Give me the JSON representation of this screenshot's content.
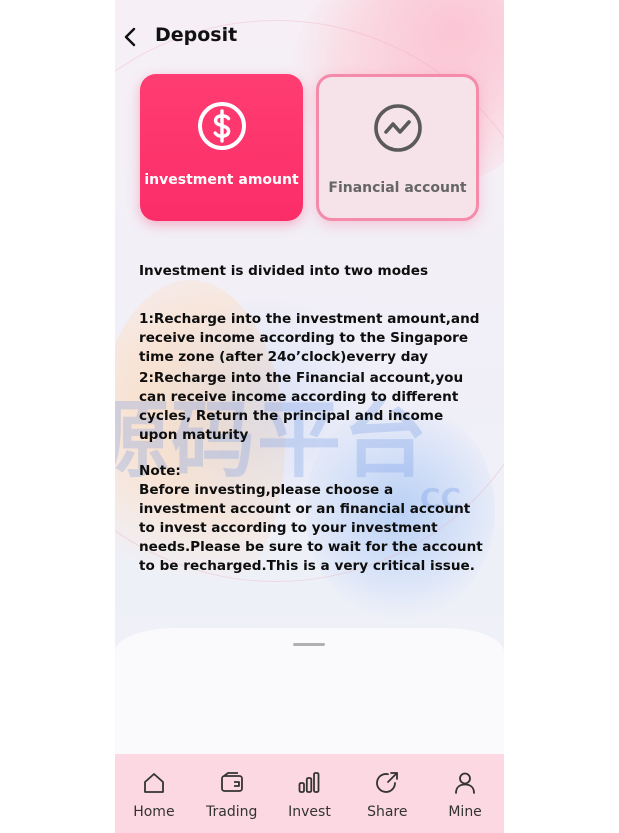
{
  "header": {
    "title": "Deposit",
    "back_icon": "chevron-left-icon"
  },
  "modes": [
    {
      "label": "investment amount",
      "icon": "dollar-circle-icon",
      "selected": true,
      "accent": "#fb3069"
    },
    {
      "label": "Financial account",
      "icon": "trend-chart-icon",
      "selected": false,
      "accent": "#f48bab"
    }
  ],
  "info": {
    "intro": "Investment is divided into two modes",
    "mode1": "1:Recharge into the investment amount,and receive income according to the Singapore time zone (after 24o’clock)everry day",
    "mode2": "2:Recharge into the Financial account,you can receive income according to different cycles, Return the principal and income upon maturity",
    "note_title": "Note:",
    "note_body": "Before investing,please choose a investment account or an financial account to invest according to your investment needs.Please be sure to wait for the account to be recharged.This is a very critical issue."
  },
  "watermark": {
    "text": "源码平台",
    "suffix": "CC"
  },
  "tabbar": {
    "background": "#fcd9e2",
    "items": [
      {
        "label": "Home",
        "icon": "home-icon"
      },
      {
        "label": "Trading",
        "icon": "wallet-icon"
      },
      {
        "label": "Invest",
        "icon": "bar-chart-icon"
      },
      {
        "label": "Share",
        "icon": "share-icon"
      },
      {
        "label": "Mine",
        "icon": "user-icon"
      }
    ]
  }
}
